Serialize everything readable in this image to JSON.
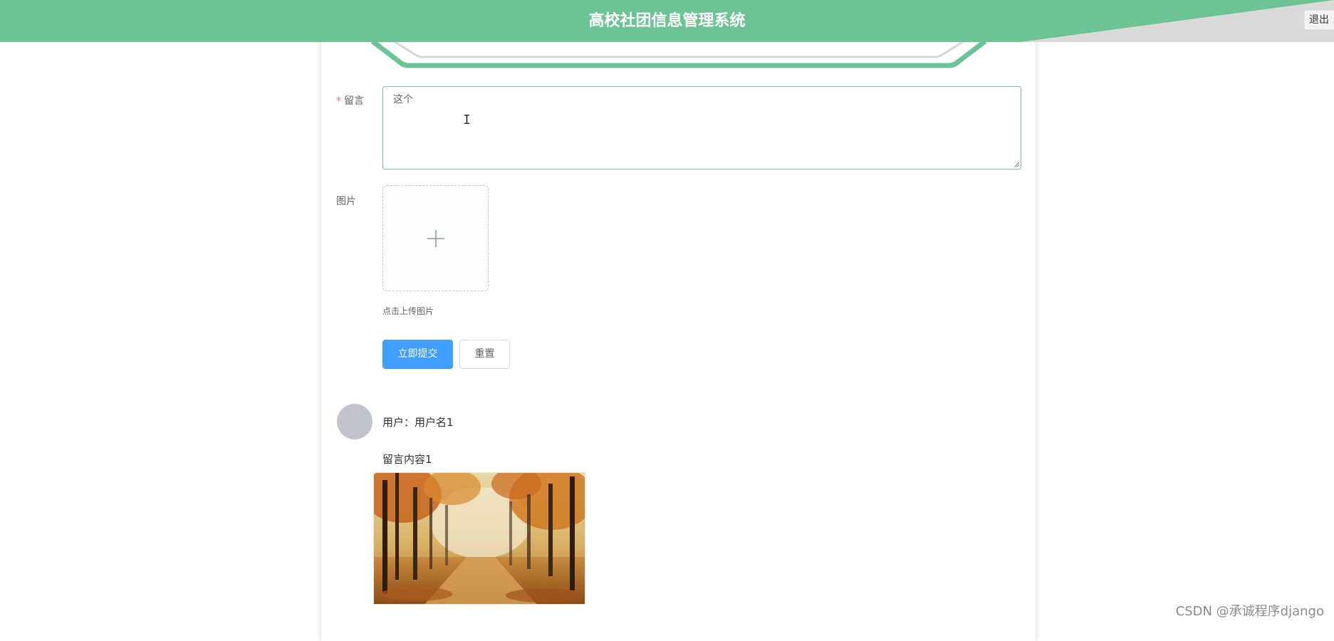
{
  "header": {
    "title": "高校社团信息管理系统",
    "logout_label": "退出",
    "bg_color": "#6cc393"
  },
  "form": {
    "message_label": "留言",
    "message_required_mark": "*",
    "message_value": "这个",
    "image_label": "图片",
    "upload_icon": "plus-icon",
    "upload_tip": "点击上传图片",
    "submit_label": "立即提交",
    "reset_label": "重置",
    "primary_color": "#409eff"
  },
  "comment": {
    "user_line": "用户：用户名1",
    "content": "留言内容1",
    "image_description": "autumn-forest-photo"
  },
  "watermark": "CSDN @承诚程序django"
}
